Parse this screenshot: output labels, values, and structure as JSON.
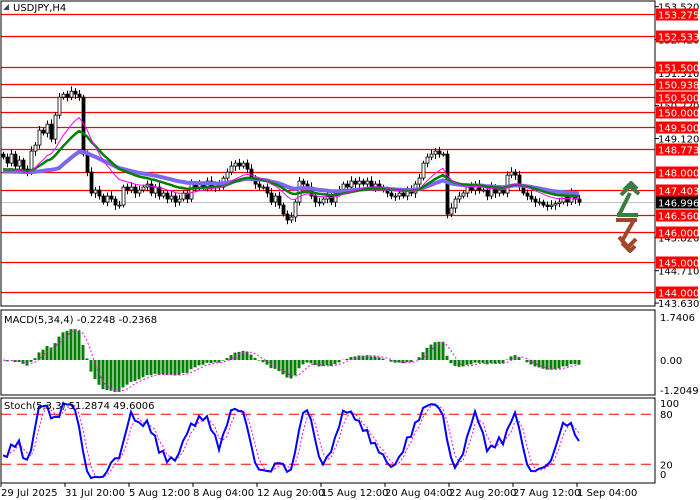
{
  "header": {
    "symbol_label": "USDJPY,H4"
  },
  "colors": {
    "level": "#ff0000",
    "ma_fast": "#ff00ff",
    "ma_mid": "#008000",
    "ma_slow": "#7b68ee",
    "macd_hist": "#008000",
    "signal": "#ff00ff",
    "stoch_main": "#0000ff",
    "stoch_signal": "#ff00ff",
    "arrow_up": "#3a7d44",
    "arrow_down": "#a0472a"
  },
  "chart_data": [
    {
      "type": "candlestick",
      "title": "USDJPY,H4",
      "ylim": [
        143.63,
        153.52
      ],
      "price_axis_ticks": [
        "153.520",
        "152.420",
        "151.310",
        "150.220",
        "149.120",
        "145.820",
        "144.710",
        "143.630"
      ],
      "levels": [
        "153.275",
        "152.533",
        "151.500",
        "150.938",
        "150.500",
        "150.000",
        "149.500",
        "148.773",
        "148.000",
        "147.403",
        "146.560",
        "146.000",
        "145.000",
        "144.000"
      ],
      "current_price": "146.996",
      "time_labels": [
        "29 Jul 2025",
        "31 Jul 20:00",
        "5 Aug 12:00",
        "8 Aug 04:00",
        "12 Aug 20:00",
        "15 Aug 12:00",
        "20 Aug 04:00",
        "22 Aug 20:00",
        "27 Aug 12:00",
        "1 Sep 04:00"
      ],
      "close": [
        148.5,
        148.3,
        148.6,
        148.2,
        148.4,
        148.1,
        148.0,
        148.7,
        148.9,
        149.4,
        149.3,
        149.6,
        149.1,
        149.9,
        150.5,
        150.6,
        150.5,
        150.7,
        150.6,
        150.5,
        148.6,
        148.0,
        147.3,
        147.4,
        147.2,
        147.0,
        147.2,
        147.1,
        146.9,
        146.9,
        147.5,
        147.4,
        147.5,
        147.3,
        147.4,
        147.5,
        147.6,
        147.3,
        147.5,
        147.2,
        147.3,
        147.1,
        147.2,
        147.0,
        147.1,
        147.3,
        147.1,
        147.6,
        147.5,
        147.6,
        147.5,
        147.7,
        147.5,
        147.6,
        147.5,
        147.8,
        148.0,
        148.2,
        148.3,
        148.2,
        148.3,
        148.1,
        147.8,
        147.6,
        147.5,
        147.5,
        147.3,
        147.0,
        147.2,
        146.9,
        146.6,
        146.4,
        146.5,
        147.0,
        147.7,
        147.6,
        147.5,
        147.2,
        147.0,
        146.97,
        147.1,
        147.2,
        147.0,
        147.3,
        147.4,
        147.6,
        147.5,
        147.7,
        147.6,
        147.7,
        147.6,
        147.7,
        147.5,
        147.6,
        147.5,
        147.4,
        147.3,
        147.2,
        147.2,
        147.3,
        147.2,
        147.4,
        147.3,
        147.6,
        147.8,
        148.3,
        148.5,
        148.6,
        148.7,
        148.6,
        148.6,
        146.6,
        146.8,
        147.1,
        147.2,
        147.3,
        147.5,
        147.4,
        147.6,
        147.4,
        147.4,
        147.2,
        147.5,
        147.3,
        147.4,
        147.3,
        147.9,
        148.0,
        147.9,
        147.5,
        147.3,
        147.2,
        147.1,
        147.0,
        147.0,
        146.9,
        146.85,
        146.9,
        146.95,
        147.0,
        147.2,
        147.0,
        147.3,
        147.1,
        146.996
      ]
    },
    {
      "type": "bar",
      "label": "MACD(5,34,4) -0.2248 -0.2368",
      "ylim": [
        -1.2049,
        1.7406
      ],
      "axis_ticks": [
        "1.7406",
        "0.00",
        "-1.2049"
      ]
    },
    {
      "type": "line",
      "label": "Stoch(5,3,3) 51.2874 49.6006",
      "ylim": [
        0,
        100
      ],
      "axis_ticks": [
        "100",
        "80",
        "20",
        "0"
      ]
    }
  ]
}
